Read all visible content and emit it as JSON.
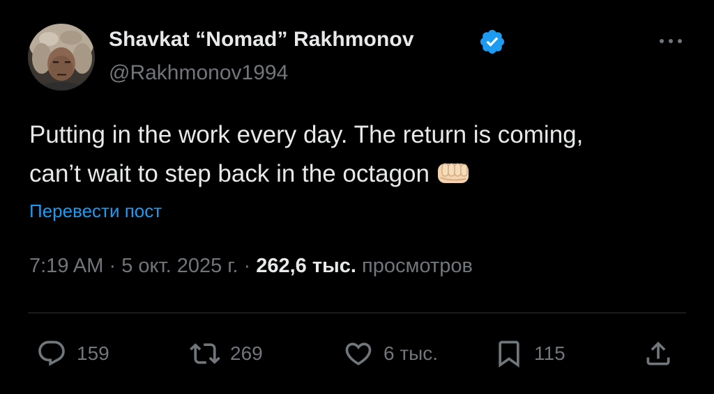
{
  "author": {
    "name": "Shavkat “Nomad” Rakhmonov",
    "handle": "@Rakhmonov1994"
  },
  "tweet": {
    "text_line1": "Putting in the work every day. The return is coming,",
    "text_line2": "can’t wait to step back in the octagon",
    "emoji": "fist-bump-emoji",
    "translate_label": "Перевести пост"
  },
  "meta": {
    "time": "7:19 AM",
    "separator": "·",
    "date": "5 окт. 2025 г.",
    "views_count": "262,6 тыс.",
    "views_label": "просмотров"
  },
  "actions": {
    "replies": "159",
    "reposts": "269",
    "likes": "6 тыс.",
    "bookmarks": "115"
  },
  "colors": {
    "background": "#000000",
    "text": "#e7e9ea",
    "secondary": "#71767b",
    "accent": "#1d9bf0",
    "divider": "#2f3336"
  }
}
